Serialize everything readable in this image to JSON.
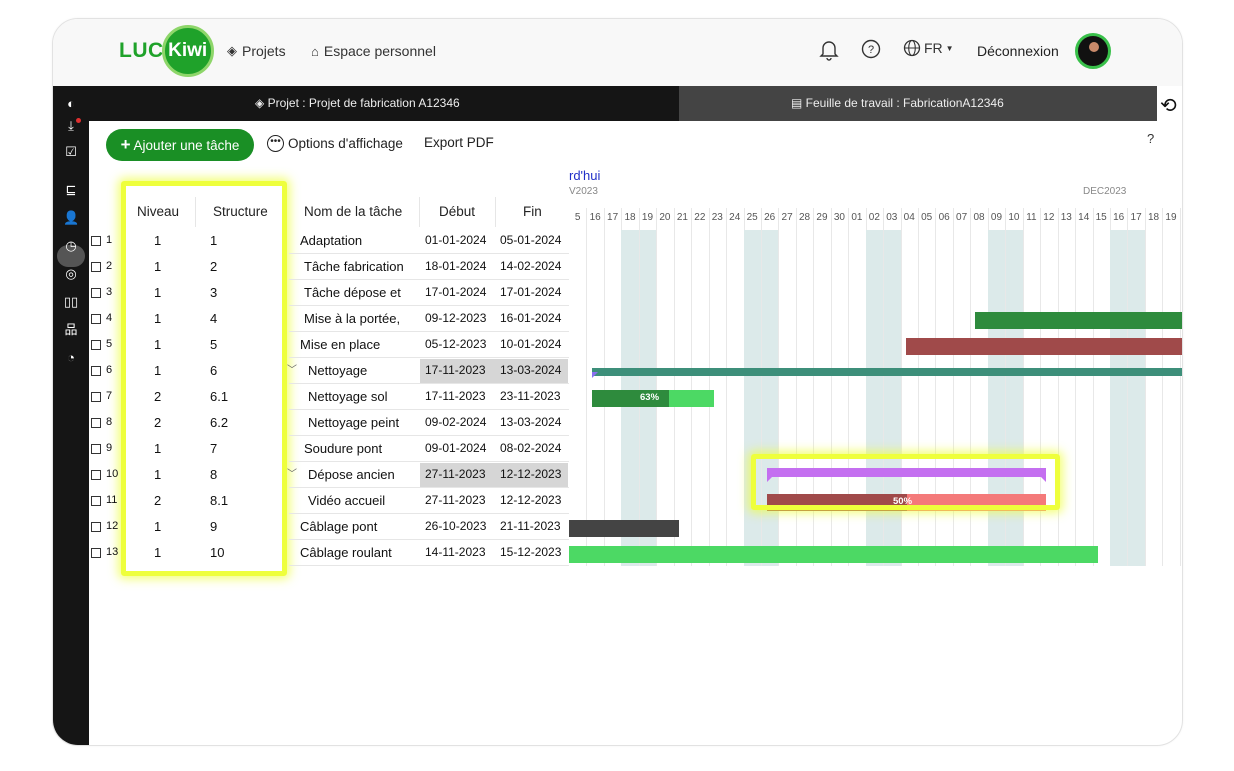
{
  "brand": {
    "logo_left": "LUC",
    "logo_right": "Kiwi"
  },
  "nav": {
    "projects": "Projets",
    "personal_space": "Espace personnel",
    "language": "FR",
    "logout": "Déconnexion"
  },
  "breadcrumb": {
    "project": "Projet : Projet de fabrication A12346",
    "worksheet": "Feuille de travail : FabricationA12346"
  },
  "toolbar": {
    "add_task": "Ajouter une tâche",
    "display_options": "Options d'affichage",
    "export_pdf": "Export PDF",
    "help": "?"
  },
  "table": {
    "headers": {
      "level": "Niveau",
      "structure": "Structure",
      "task_name": "Nom de la tâche",
      "start": "Début",
      "end": "Fin"
    },
    "rows": [
      {
        "num": "1",
        "level": "1",
        "structure": "1",
        "name": "Adaptation",
        "start": "01-01-2024",
        "end": "05-01-2024"
      },
      {
        "num": "2",
        "level": "1",
        "structure": "2",
        "name": "Tâche fabrication",
        "start": "18-01-2024",
        "end": "14-02-2024"
      },
      {
        "num": "3",
        "level": "1",
        "structure": "3",
        "name": "Tâche dépose et",
        "start": "17-01-2024",
        "end": "17-01-2024"
      },
      {
        "num": "4",
        "level": "1",
        "structure": "4",
        "name": "Mise à la portée,",
        "start": "09-12-2023",
        "end": "16-01-2024"
      },
      {
        "num": "5",
        "level": "1",
        "structure": "5",
        "name": "Mise en place",
        "start": "05-12-2023",
        "end": "10-01-2024"
      },
      {
        "num": "6",
        "level": "1",
        "structure": "6",
        "name": "Nettoyage",
        "start": "17-11-2023",
        "end": "13-03-2024"
      },
      {
        "num": "7",
        "level": "2",
        "structure": "6.1",
        "name": "Nettoyage sol",
        "start": "17-11-2023",
        "end": "23-11-2023"
      },
      {
        "num": "8",
        "level": "2",
        "structure": "6.2",
        "name": "Nettoyage peint",
        "start": "09-02-2024",
        "end": "13-03-2024"
      },
      {
        "num": "9",
        "level": "1",
        "structure": "7",
        "name": "Soudure pont",
        "start": "09-01-2024",
        "end": "08-02-2024"
      },
      {
        "num": "10",
        "level": "1",
        "structure": "8",
        "name": "Dépose ancien",
        "start": "27-11-2023",
        "end": "12-12-2023"
      },
      {
        "num": "11",
        "level": "2",
        "structure": "8.1",
        "name": "Vidéo accueil",
        "start": "27-11-2023",
        "end": "12-12-2023"
      },
      {
        "num": "12",
        "level": "1",
        "structure": "9",
        "name": "Câblage pont",
        "start": "26-10-2023",
        "end": "21-11-2023"
      },
      {
        "num": "13",
        "level": "1",
        "structure": "10",
        "name": "Câblage roulant",
        "start": "14-11-2023",
        "end": "15-12-2023"
      }
    ]
  },
  "gantt": {
    "today_label": "rd'hui",
    "month_left": "V2023",
    "month_right": "DEC2023",
    "days": [
      "5",
      "16",
      "17",
      "18",
      "19",
      "20",
      "21",
      "22",
      "23",
      "24",
      "25",
      "26",
      "27",
      "28",
      "29",
      "30",
      "01",
      "02",
      "03",
      "04",
      "05",
      "06",
      "07",
      "08",
      "09",
      "10",
      "11",
      "12",
      "13",
      "14",
      "15",
      "16",
      "17",
      "18",
      "19",
      "20"
    ],
    "progress_labels": {
      "nettoyage_sol": "63%",
      "video_accueil": "50%"
    },
    "colors": {
      "dark_green": "#2e8b3d",
      "light_green": "#4cd964",
      "dark_red": "#a04a4a",
      "light_red": "#f47a7a",
      "teal": "#3d8f7a",
      "purple": "#c46ff0",
      "dark_gray": "#444444",
      "highlight": "#eeff3c"
    }
  }
}
